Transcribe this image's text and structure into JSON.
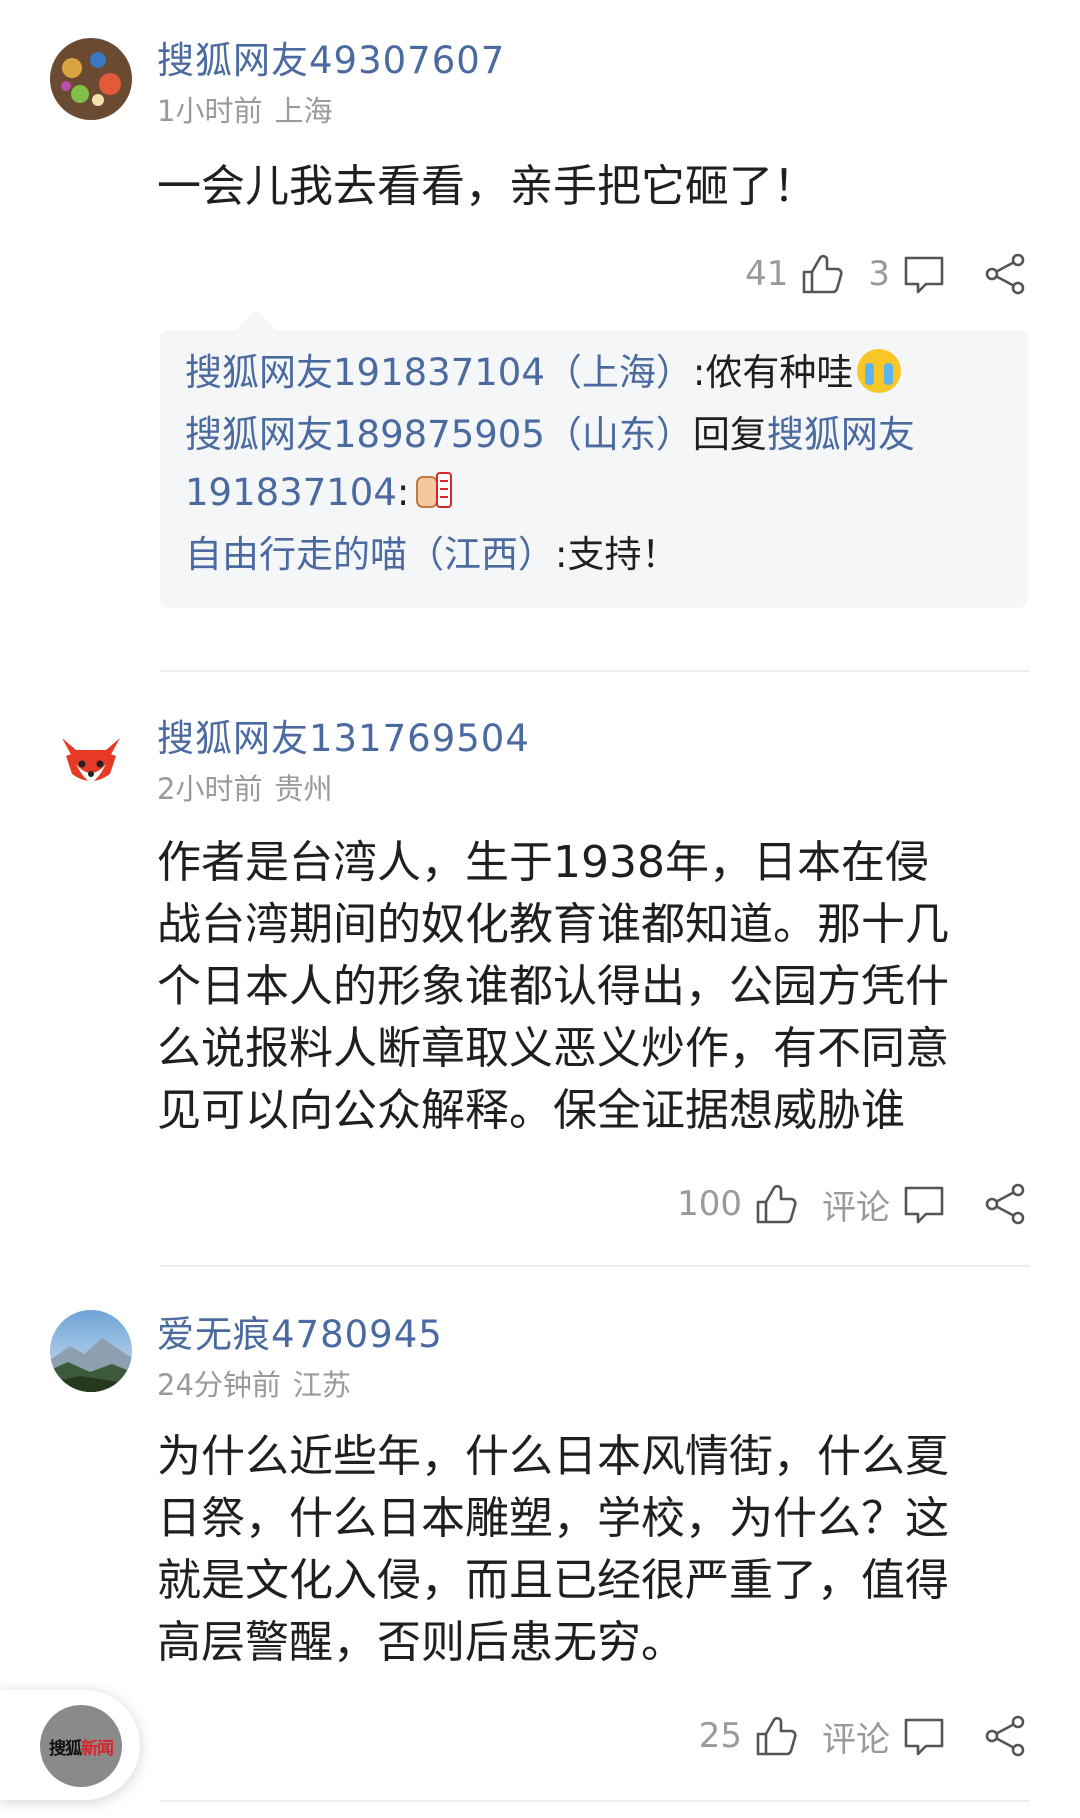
{
  "comments": [
    {
      "username": "搜狐网友49307607",
      "time": "1小时前",
      "location": "上海",
      "lines": [
        "一会儿我去看看，亲手把它砸了！"
      ],
      "likes": "41",
      "comments": "3",
      "avatar": "colorful-avatar-icon",
      "replies": [
        {
          "who": "搜狐网友191837104（上海）",
          "text": ":侬有种哇",
          "emoji": "crying-face-emoji"
        },
        {
          "who": "搜狐网友189875905（山东）",
          "mid": "回复",
          "who2a": "搜狐网友",
          "who2b": "191837104",
          "text": ":",
          "emoji": "fist-power-emoji"
        },
        {
          "who": "自由行走的喵（江西）",
          "text": ":支持！"
        }
      ]
    },
    {
      "username": "搜狐网友131769504",
      "time": "2小时前",
      "location": "贵州",
      "lines": [
        "作者是台湾人，生于1938年，日本在侵",
        "战台湾期间的奴化教育谁都知道。那十几",
        "个日本人的形象谁都认得出，公园方凭什",
        "么说报料人断章取义恶义炒作，有不同意",
        "见可以向公众解释。保全证据想威胁谁"
      ],
      "likes": "100",
      "comments": "评论",
      "avatar": "fox-avatar-icon"
    },
    {
      "username": "爱无痕4780945",
      "time": "24分钟前",
      "location": "江苏",
      "lines": [
        "为什么近些年，什么日本风情街，什么夏",
        "日祭，什么日本雕塑，学校，为什么？这",
        "就是文化入侵，而且已经很严重了，值得",
        "高层警醒，否则后患无穷。"
      ],
      "likes": "25",
      "comments": "评论",
      "avatar": "mountain-avatar-icon"
    }
  ],
  "floating_logo": {
    "part1": "搜狐",
    "part2": "新闻"
  },
  "colors": {
    "link": "#4a6aa0",
    "meta": "#9a9a9a",
    "text": "#1f1f1f",
    "reply_bg": "#f5f6f8"
  }
}
